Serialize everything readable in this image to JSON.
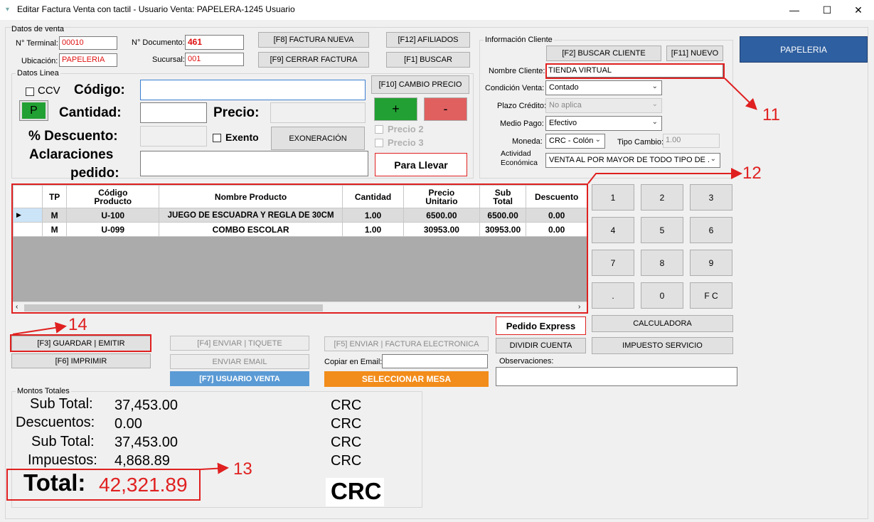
{
  "window": {
    "title": "Editar Factura Venta con tactil - Usuario Venta: PAPELERA-1245 Usuario",
    "minimize": "—",
    "maximize": "☐",
    "close": "✕"
  },
  "datos_venta": {
    "group_label": "Datos de venta",
    "terminal_label": "N° Terminal:",
    "terminal_value": "00010",
    "documento_label": "N° Documento:",
    "documento_value": "461",
    "ubicacion_label": "Ubicación:",
    "ubicacion_value": "PAPELERIA",
    "sucursal_label": "Sucursal:",
    "sucursal_value": "001",
    "btn_factura_nueva": "[F8] FACTURA NUEVA",
    "btn_cerrar_factura": "[F9] CERRAR FACTURA",
    "btn_afiliados": "[F12] AFILIADOS",
    "btn_buscar": "[F1] BUSCAR"
  },
  "datos_linea": {
    "group_label": "Datos Linea",
    "ccv_label": "CCV",
    "p_button": "P",
    "codigo_label": "Código:",
    "codigo_value": "",
    "cantidad_label": "Cantidad:",
    "cantidad_value": "",
    "precio_label": "Precio:",
    "precio_value": "",
    "descuento_label": "% Descuento:",
    "descuento_value": "",
    "exento_label": "Exento",
    "exoneracion_button": "EXONERACIÓN",
    "aclaraciones_label_1": "Aclaraciones",
    "aclaraciones_label_2": "pedido:",
    "aclaraciones_value": "",
    "cambio_precio_button": "[F10] CAMBIO PRECIO",
    "plus_button": "+",
    "minus_button": "-",
    "precio2_label": "Precio 2",
    "precio3_label": "Precio 3",
    "para_llevar_button": "Para Llevar"
  },
  "cliente": {
    "group_label": "Información Cliente",
    "buscar_cliente_button": "[F2] BUSCAR CLIENTE",
    "nuevo_button": "[F11] NUEVO",
    "nombre_label": "Nombre Cliente:",
    "nombre_value": "TIENDA  VIRTUAL",
    "condicion_label": "Condición Venta:",
    "condicion_value": "Contado",
    "plazo_label": "Plazo Crédito:",
    "plazo_value": "No aplica",
    "medio_label": "Medio Pago:",
    "medio_value": "Efectivo",
    "moneda_label": "Moneda:",
    "moneda_value": "CRC - Colón",
    "tipo_cambio_label": "Tipo Cambio:",
    "tipo_cambio_value": "1.00",
    "actividad_label_1": "Actividad",
    "actividad_label_2": "Económica",
    "actividad_value": "VENTA AL POR MAYOR DE TODO TIPO DE ..."
  },
  "papeleria_button": "PAPELERIA",
  "grid": {
    "headers": [
      "TP",
      "Código\nProducto",
      "Nombre Producto",
      "Cantidad",
      "Precio\nUnitario",
      "Sub\nTotal",
      "Descuento"
    ],
    "h_tp": "TP",
    "h_codigo_1": "Código",
    "h_codigo_2": "Producto",
    "h_nombre": "Nombre Producto",
    "h_cantidad": "Cantidad",
    "h_precio_1": "Precio",
    "h_precio_2": "Unitario",
    "h_sub_1": "Sub",
    "h_sub_2": "Total",
    "h_descuento": "Descuento",
    "rows": [
      {
        "tp": "M",
        "codigo": "U-100",
        "nombre": "JUEGO DE ESCUADRA Y REGLA DE 30CM",
        "cantidad": "1.00",
        "precio": "6500.00",
        "subtotal": "6500.00",
        "descuento": "0.00"
      },
      {
        "tp": "M",
        "codigo": "U-099",
        "nombre": "COMBO ESCOLAR",
        "cantidad": "1.00",
        "precio": "30953.00",
        "subtotal": "30953.00",
        "descuento": "0.00"
      }
    ]
  },
  "keypad": {
    "keys": [
      "1",
      "2",
      "3",
      "4",
      "5",
      "6",
      "7",
      "8",
      "9",
      ".",
      "0",
      "F C"
    ],
    "calculadora": "CALCULADORA",
    "impuesto_servicio": "IMPUESTO SERVICIO",
    "pedido_express": "Pedido Express",
    "dividir_cuenta": "DIVIDIR CUENTA"
  },
  "actions": {
    "guardar": "[F3] GUARDAR | EMITIR",
    "imprimir": "[F6] IMPRIMIR",
    "enviar_tiquete": "[F4] ENVIAR | TIQUETE",
    "enviar_email": "ENVIAR EMAIL",
    "usuario_venta": "[F7] USUARIO VENTA",
    "enviar_factura": "[F5] ENVIAR | FACTURA ELECTRONICA",
    "copiar_email_label": "Copiar en Email:",
    "copiar_email_value": "",
    "seleccionar_mesa": "SELECCIONAR MESA",
    "observaciones_label": "Observaciones:",
    "observaciones_value": ""
  },
  "totales": {
    "group_label": "Montos Totales",
    "subtotal_label": "Sub Total:",
    "subtotal_value": "37,453.00",
    "subtotal_cur": "CRC",
    "descuentos_label": "Descuentos:",
    "descuentos_value": "0.00",
    "descuentos_cur": "CRC",
    "subtotal2_label": "Sub Total:",
    "subtotal2_value": "37,453.00",
    "subtotal2_cur": "CRC",
    "impuestos_label": "Impuestos:",
    "impuestos_value": "4,868.89",
    "impuestos_cur": "CRC",
    "total_label": "Total:",
    "total_value": "42,321.89",
    "total_cur": "CRC"
  },
  "annotations": {
    "a11": "11",
    "a12": "12",
    "a13": "13",
    "a14": "14"
  },
  "colors": {
    "accent_red": "#e02020",
    "green": "#22a033",
    "salmon": "#e06060",
    "blue_btn": "#2e5fa0",
    "usuario_blue": "#5b9bd5",
    "orange": "#f28c1a"
  }
}
